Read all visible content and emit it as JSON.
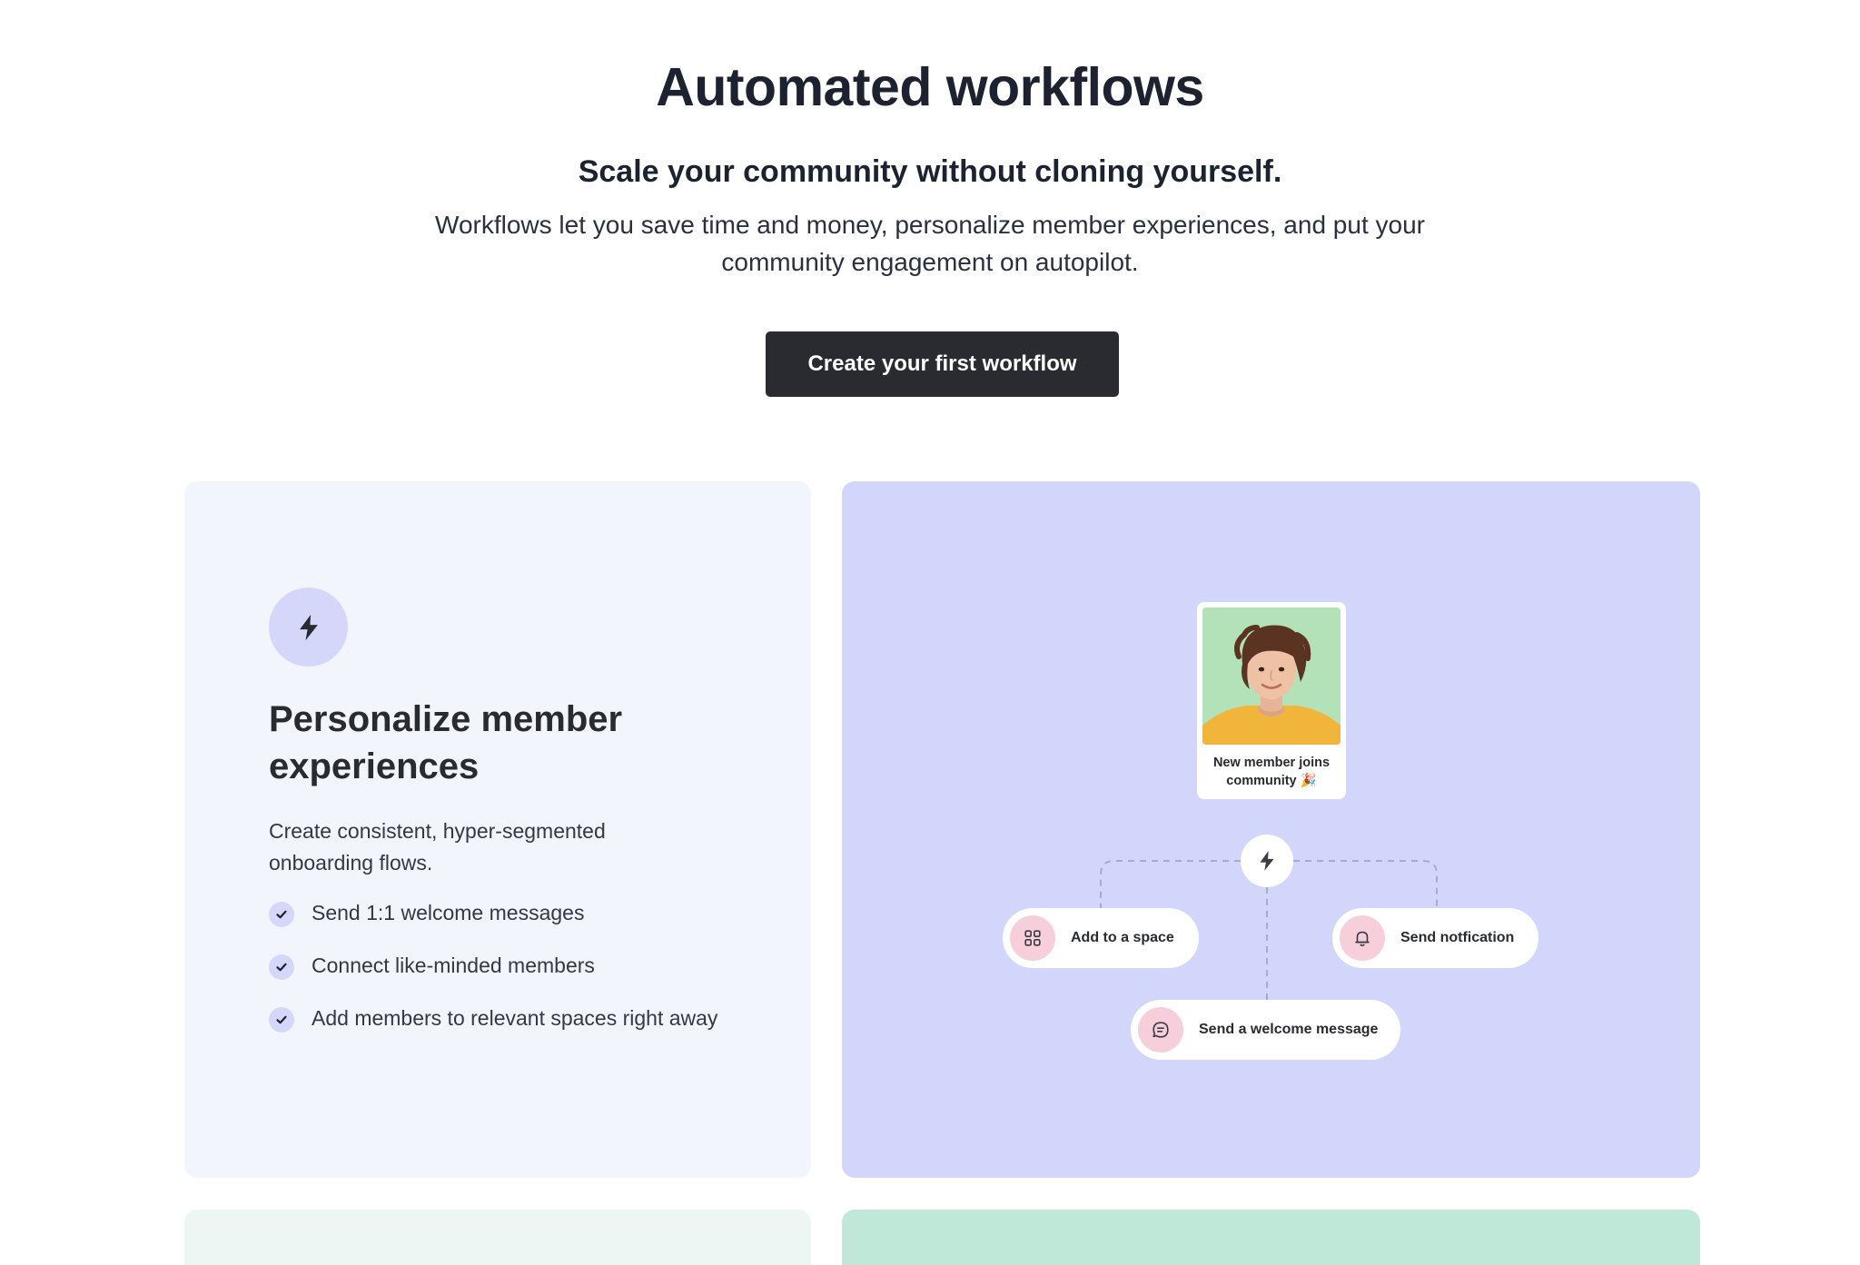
{
  "hero": {
    "title": "Automated workflows",
    "subtitle": "Scale your community without cloning yourself.",
    "description": "Workflows let you save time and money, personalize member experiences, and put your community engagement on autopilot.",
    "cta_label": "Create your first workflow"
  },
  "feature": {
    "icon": "bolt-icon",
    "title": "Personalize member experiences",
    "description": "Create consistent, hyper-segmented onboarding flows.",
    "items": [
      {
        "label": "Send 1:1 welcome messages",
        "icon": "check-icon"
      },
      {
        "label": "Connect like-minded members",
        "icon": "check-icon"
      },
      {
        "label": "Add members to relevant spaces right away",
        "icon": "check-icon"
      }
    ]
  },
  "illustration": {
    "trigger": {
      "caption": "New member joins community 🎉",
      "icon": "avatar-photo"
    },
    "hub_icon": "bolt-icon",
    "actions": [
      {
        "label": "Add to a space",
        "icon": "grid-icon"
      },
      {
        "label": "Send notfication",
        "icon": "bell-icon"
      },
      {
        "label": "Send a welcome message",
        "icon": "chat-icon"
      }
    ]
  },
  "colors": {
    "cta_bg": "#2a2b30",
    "feature_card_bg": "#f3f5fd",
    "illustration_bg": "#d2d6fa",
    "icon_circle_bg": "#d4d7fa",
    "action_icon_bg": "#f7cfda",
    "bottom_left_bg": "#eef6f3",
    "bottom_right_bg": "#bfe8d9"
  }
}
